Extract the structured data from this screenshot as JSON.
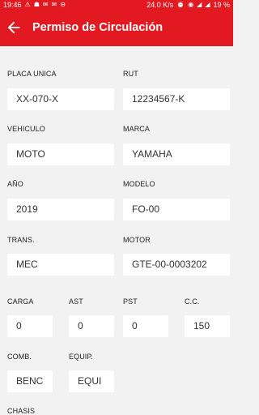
{
  "status_bar": {
    "time": "19:46",
    "network_speed": "24.0 K/s",
    "battery": "19 %",
    "icons": [
      "warning-icon",
      "android-icon",
      "email-icon",
      "email-icon",
      "vpn-icon",
      "alarm-icon",
      "wifi-icon",
      "signal-icon",
      "signal-icon",
      "battery-icon"
    ]
  },
  "app_bar": {
    "back_icon": "arrow-left-icon",
    "title": "Permiso de Circulación",
    "color": "#e21921"
  },
  "fields": {
    "placa": {
      "label": "PLACA UNICA",
      "value": "XX-070-X"
    },
    "rut": {
      "label": "RUT",
      "value": "12234567-K"
    },
    "vehiculo": {
      "label": "VEHICULO",
      "value": "MOTO"
    },
    "marca": {
      "label": "MARCA",
      "value": "YAMAHA"
    },
    "anio": {
      "label": "AÑO",
      "value": "2019"
    },
    "modelo": {
      "label": "MODELO",
      "value": "FO-00"
    },
    "trans": {
      "label": "TRANS.",
      "value": "MEC"
    },
    "motor": {
      "label": "MOTOR",
      "value": "GTE-00-0003202"
    },
    "carga": {
      "label": "CARGA",
      "value": "0"
    },
    "ast": {
      "label": "AST",
      "value": "0"
    },
    "pst": {
      "label": "PST",
      "value": "0"
    },
    "cc": {
      "label": "C.C.",
      "value": "150"
    },
    "comb": {
      "label": "COMB.",
      "value": "BENC"
    },
    "equip": {
      "label": "EQUIP.",
      "value": "EQUI"
    },
    "chasis": {
      "label": "CHASIS"
    }
  }
}
